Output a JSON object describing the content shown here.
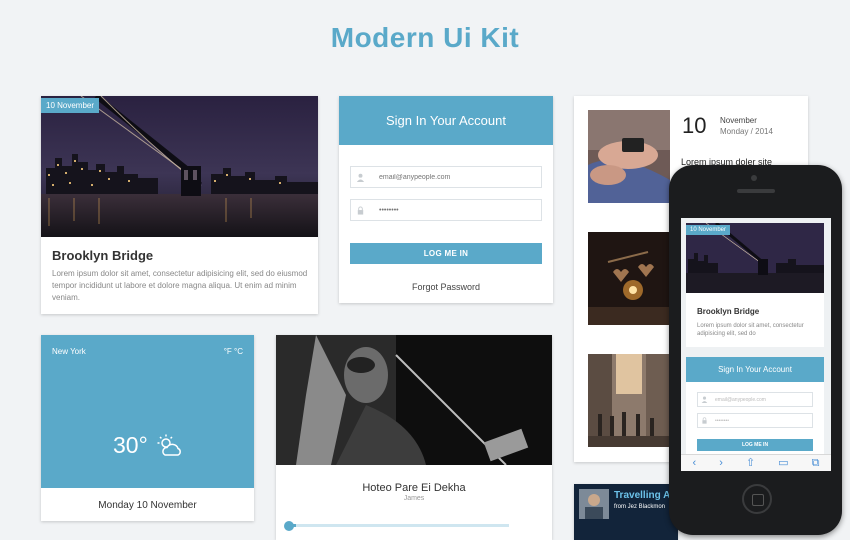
{
  "page_title": "Modern Ui Kit",
  "brooklyn_card": {
    "date_tag": "10 November",
    "title": "Brooklyn Bridge",
    "text": "Lorem ipsum dolor sit amet, consectetur adipisicing elit, sed do eiusmod tempor incididunt ut labore et dolore magna aliqua. Ut enim ad minim veniam."
  },
  "signin_card": {
    "header": "Sign In Your Account",
    "email_placeholder": "email@anypeople.com",
    "password_placeholder": "••••••••",
    "login_label": "LOG ME IN",
    "forgot_label": "Forgot Password"
  },
  "feed_card": {
    "day": "10",
    "month": "November",
    "weekday_year": "Monday / 2014",
    "headline": "Lorem ipsum doler site"
  },
  "weather_card": {
    "city": "New York",
    "units": "°F °C",
    "temperature": "30°",
    "date": "Monday 10 November",
    "icon": "partly-cloudy-icon"
  },
  "music_card": {
    "title": "Hoteo Pare Ei Dekha",
    "artist": "James",
    "progress": 0.03
  },
  "video_card": {
    "title": "Travelling A",
    "byline": "from Jez Blackmon"
  },
  "phone": {
    "card_date_tag": "10 November",
    "card_title": "Brooklyn Bridge",
    "card_text": "Lorem ipsum dolor sit amet, consectetur adipisicing elit, sed do",
    "signin_header": "Sign In Your Account",
    "email_placeholder": "email@anypeople.com",
    "password_placeholder": "••••••••",
    "login_label": "LOG ME IN",
    "toolbar": [
      "‹",
      "›",
      "⇧",
      "▭",
      "⧉"
    ]
  },
  "colors": {
    "accent": "#5aa9c9",
    "background": "#f1f3f5"
  }
}
